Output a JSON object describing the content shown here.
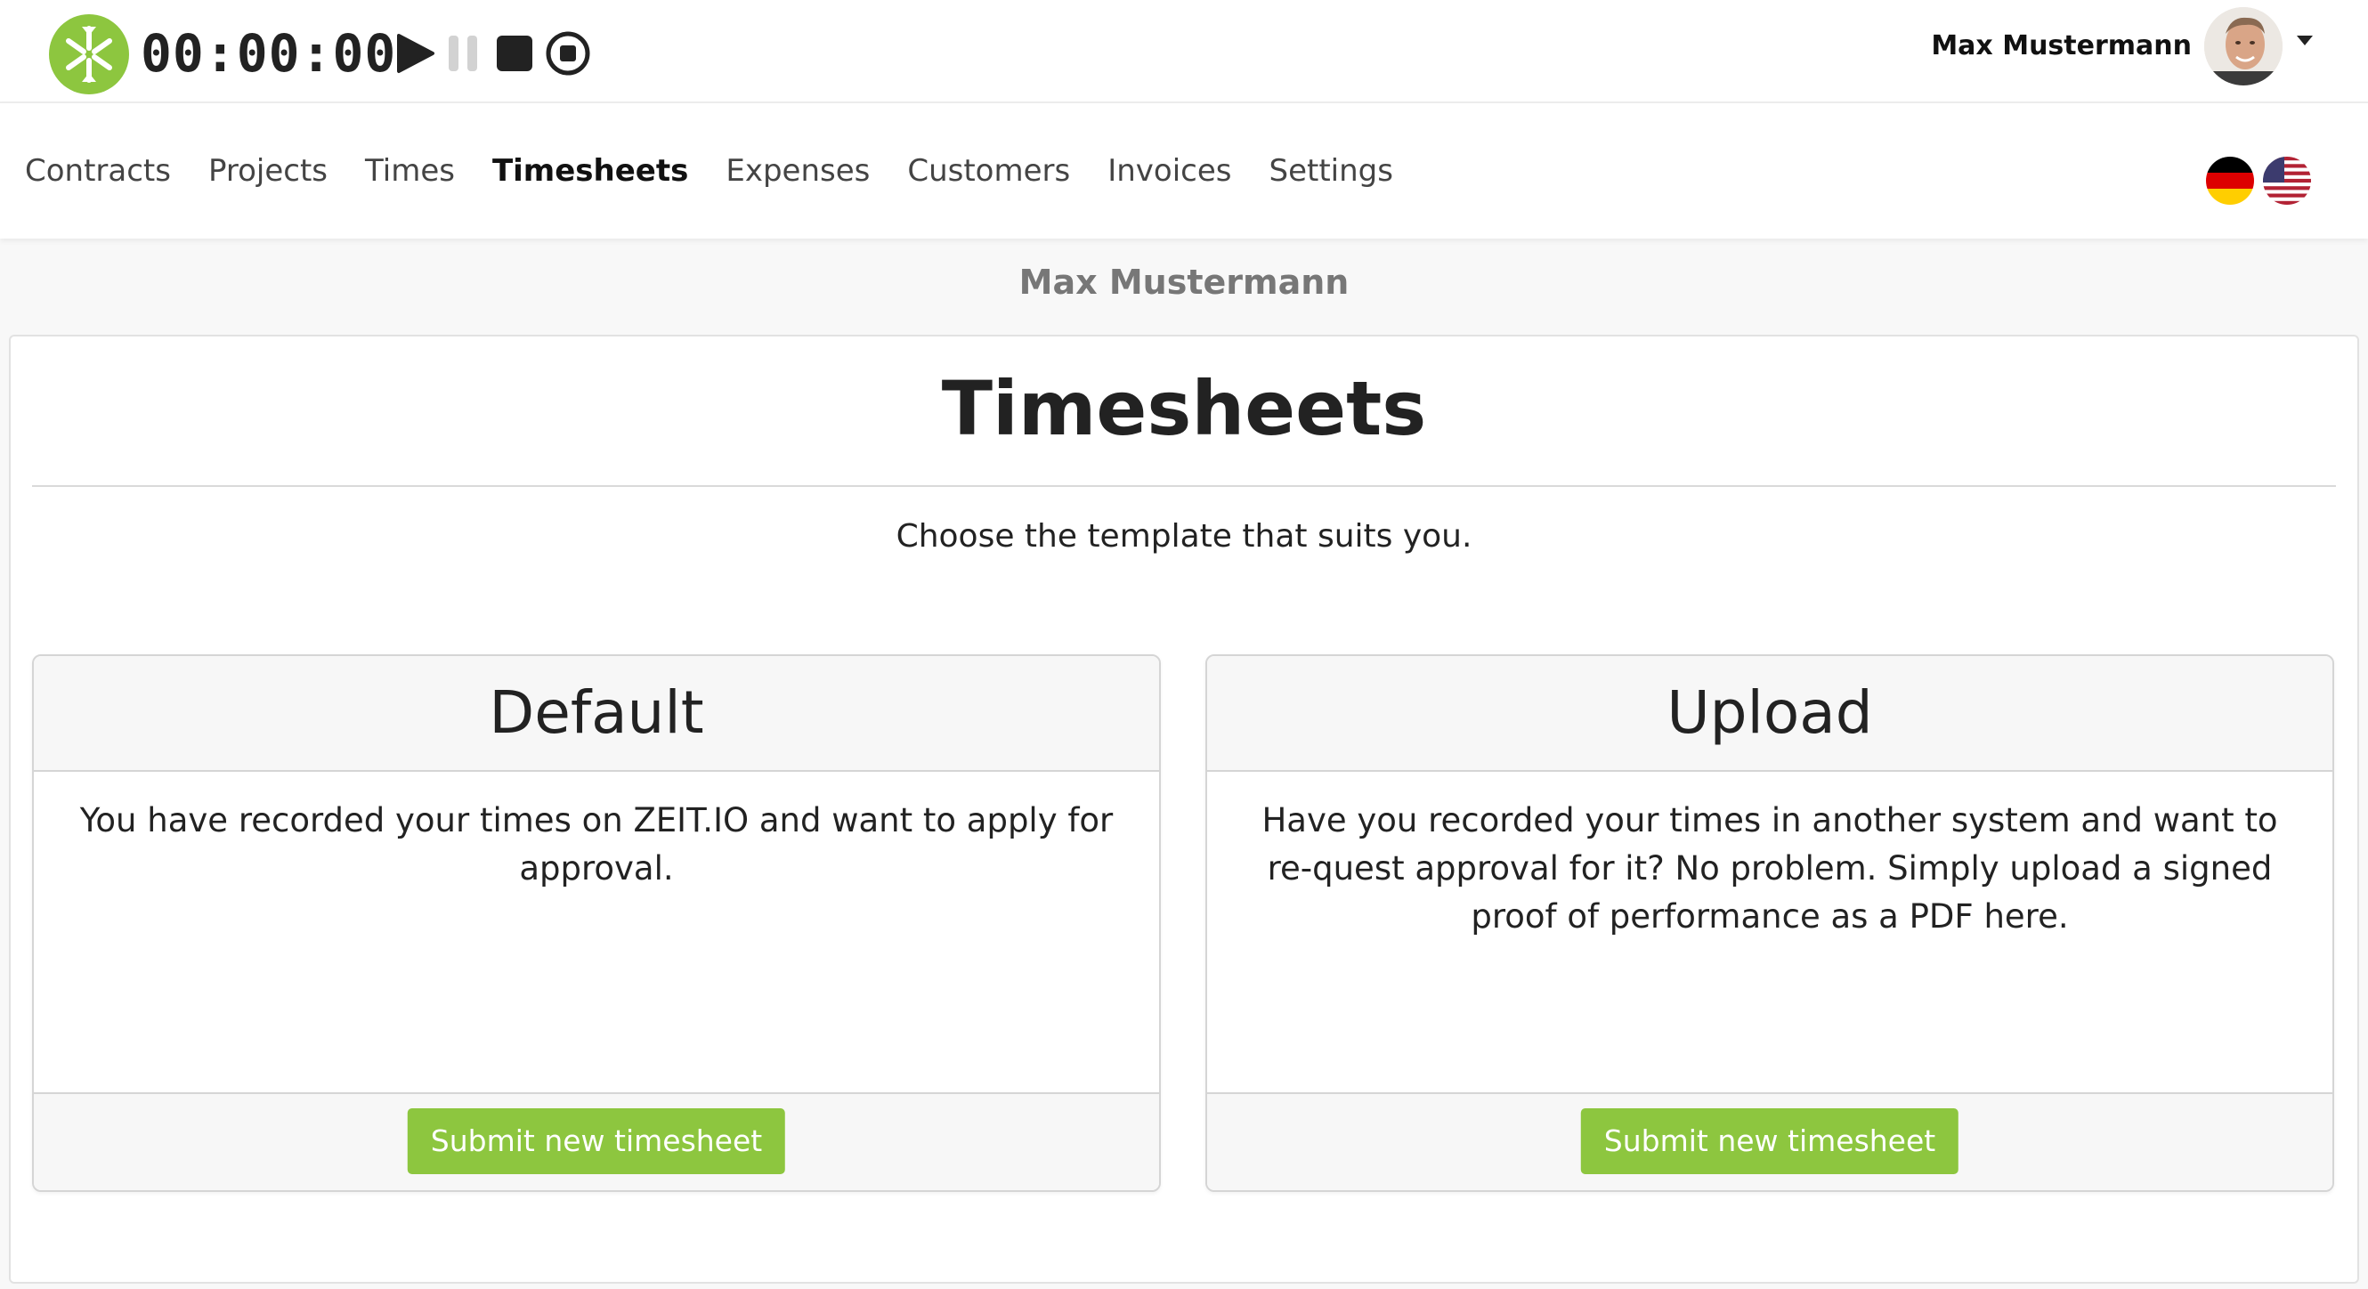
{
  "colors": {
    "accent": "#8dc63f"
  },
  "timer": {
    "display": "00:00:00",
    "controls": [
      "play-icon",
      "pause-icon",
      "stop-icon",
      "record-icon"
    ]
  },
  "user": {
    "name": "Max Mustermann"
  },
  "nav": {
    "items": [
      {
        "label": "Contracts"
      },
      {
        "label": "Projects"
      },
      {
        "label": "Times"
      },
      {
        "label": "Timesheets",
        "active": true
      },
      {
        "label": "Expenses"
      },
      {
        "label": "Customers"
      },
      {
        "label": "Invoices"
      },
      {
        "label": "Settings"
      }
    ],
    "languages": [
      "german-flag-icon",
      "us-flag-icon"
    ]
  },
  "page": {
    "user_heading": "Max Mustermann",
    "title": "Timesheets",
    "subtitle": "Choose the template that suits you."
  },
  "cards": [
    {
      "title": "Default",
      "description": "You have recorded your times on ZEIT.IO and want to apply for approval.",
      "button": "Submit new timesheet"
    },
    {
      "title": "Upload",
      "description": "Have you recorded your times in another system and want to re-quest approval for it? No problem. Simply upload a signed proof of performance as a PDF here.",
      "button": "Submit new timesheet"
    }
  ]
}
